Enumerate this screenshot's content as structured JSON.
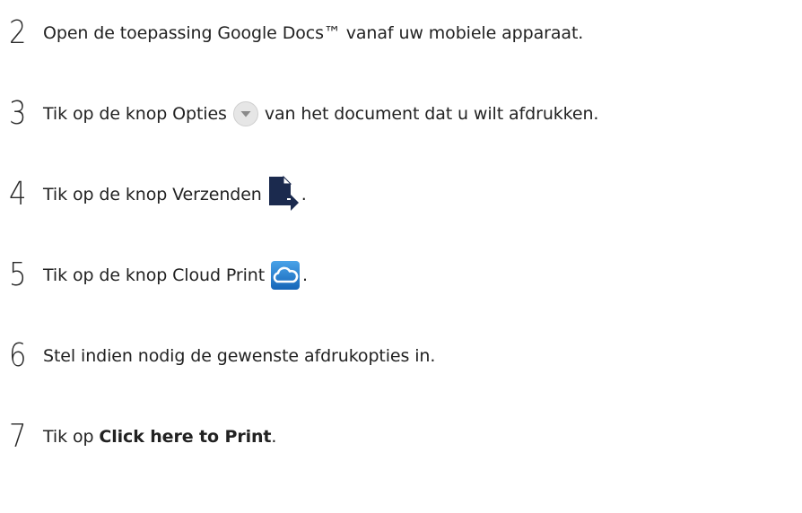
{
  "steps": [
    {
      "number": "2",
      "text": "Open de toepassing Google Docs™ vanaf uw mobiele apparaat."
    },
    {
      "number": "3",
      "text_before": "Tik op de knop Opties",
      "icon": "options-dropdown-icon",
      "text_after": "van het document dat u wilt afdrukken."
    },
    {
      "number": "4",
      "text_before": "Tik op de knop Verzenden",
      "icon": "send-document-icon",
      "text_after": "."
    },
    {
      "number": "5",
      "text_before": "Tik op de knop Cloud Print",
      "icon": "cloud-print-icon",
      "text_after": "."
    },
    {
      "number": "6",
      "text": "Stel indien nodig de gewenste afdrukopties in."
    },
    {
      "number": "7",
      "text_before": "Tik op ",
      "bold_text": "Click here to Print",
      "text_after": "."
    }
  ],
  "colors": {
    "options_icon_fill": "#e6e6e6",
    "options_icon_arrow": "#8a8a8a",
    "send_icon": "#1b2a4e",
    "cloud_icon_bg": "#1e78c8",
    "cloud_icon_line": "#ffffff"
  }
}
